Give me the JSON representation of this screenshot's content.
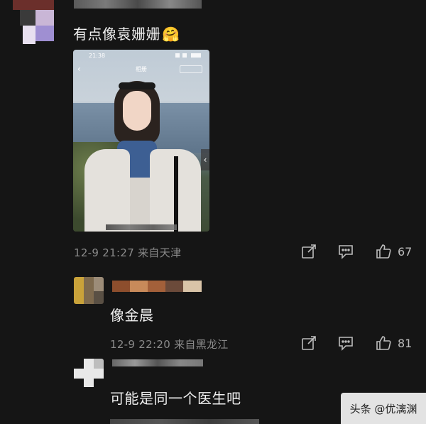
{
  "comments": [
    {
      "text": "有点像袁姗姗",
      "emoji": "🤗",
      "meta": "12-9 21:27 来自天津",
      "likes": "67"
    },
    {
      "text": "像金晨",
      "meta": "12-9 22:20 来自黑龙江",
      "likes": "81"
    },
    {
      "text": "可能是同一个医生吧"
    }
  ],
  "photo": {
    "status_time": "21:38",
    "top_label": "相册",
    "side_handle": "‹"
  },
  "watermark": {
    "text": "头条 @优漓渊"
  },
  "colors": {
    "background": "#151515",
    "meta": "#8a8a8a",
    "text": "#f0f0f0"
  }
}
